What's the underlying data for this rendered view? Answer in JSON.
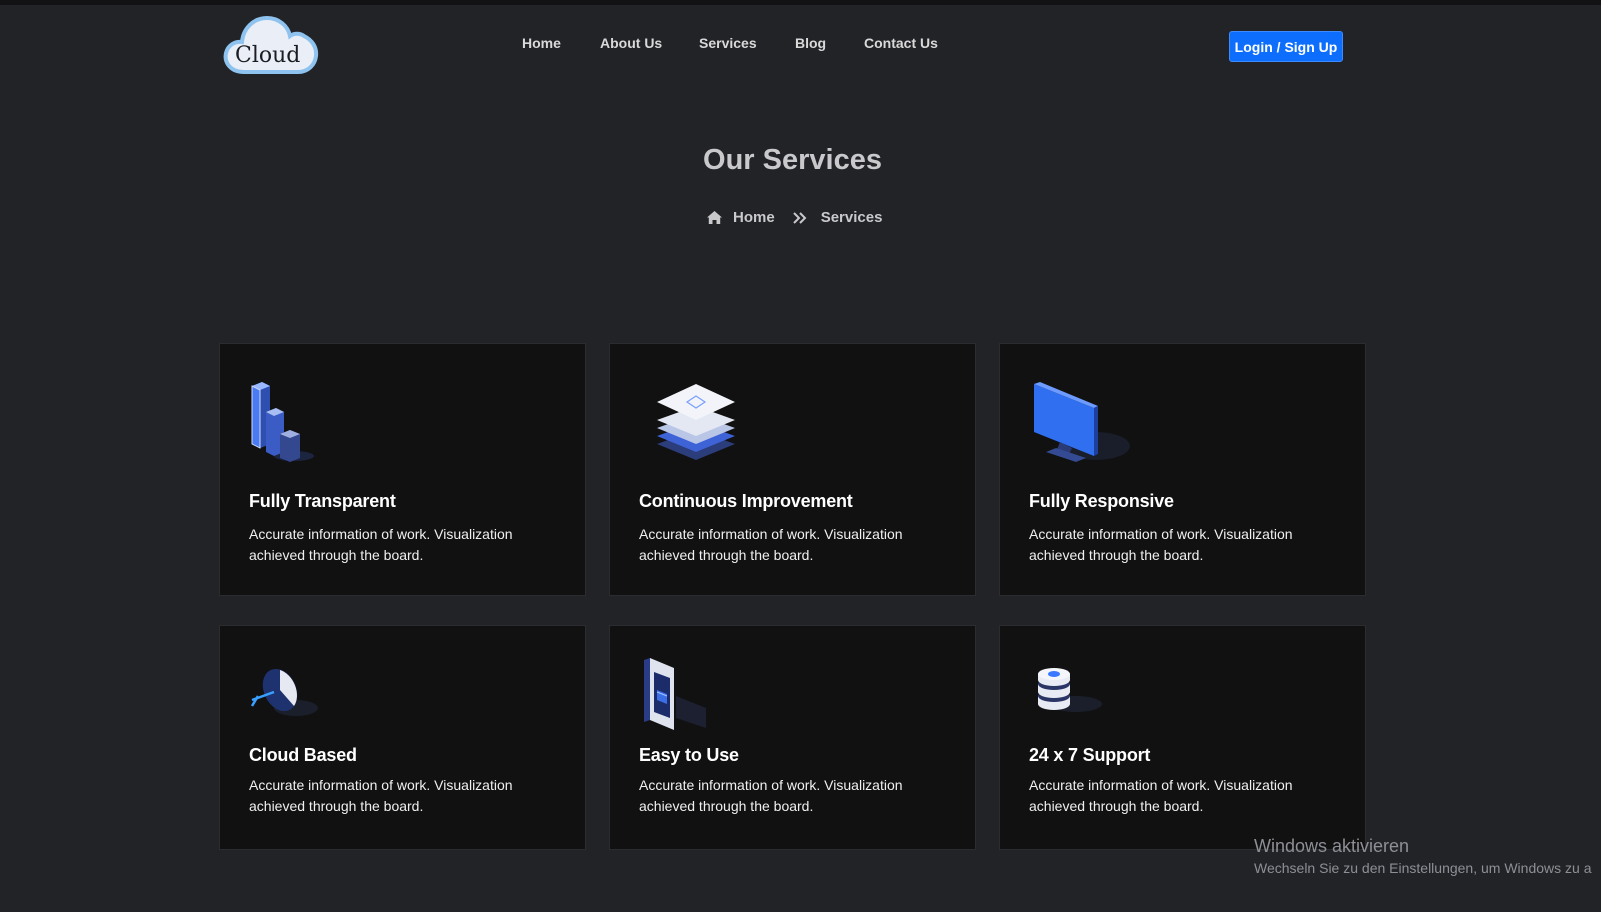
{
  "brand": {
    "logo_text": "Cloud"
  },
  "nav": {
    "items": [
      "Home",
      "About Us",
      "Services",
      "Blog",
      "Contact Us"
    ],
    "login_label": "Login / Sign Up"
  },
  "hero": {
    "title": "Our Services",
    "breadcrumb": {
      "home": "Home",
      "current": "Services"
    }
  },
  "services": [
    {
      "title": "Fully Transparent",
      "text": "Accurate information of work. Visualization achieved through the board.",
      "icon": "bar-chart-icon"
    },
    {
      "title": "Continuous Improvement",
      "text": "Accurate information of work. Visualization achieved through the board.",
      "icon": "layers-icon"
    },
    {
      "title": "Fully Responsive",
      "text": "Accurate information of work. Visualization achieved through the board.",
      "icon": "monitor-icon"
    },
    {
      "title": "Cloud Based",
      "text": "Accurate information of work. Visualization achieved through the board.",
      "icon": "pie-chart-icon"
    },
    {
      "title": "Easy to Use",
      "text": "Accurate information of work. Visualization achieved through the board.",
      "icon": "phone-icon"
    },
    {
      "title": "24 x 7 Support",
      "text": "Accurate information of work. Visualization achieved through the board.",
      "icon": "database-icon"
    }
  ],
  "os_watermark": {
    "title": "Windows aktivieren",
    "subtitle": "Wechseln Sie zu den Einstellungen, um Windows zu a"
  },
  "colors": {
    "background": "#222327",
    "card": "#111112",
    "accent": "#0d6efd",
    "icon_blue": "#2f6ff0"
  }
}
